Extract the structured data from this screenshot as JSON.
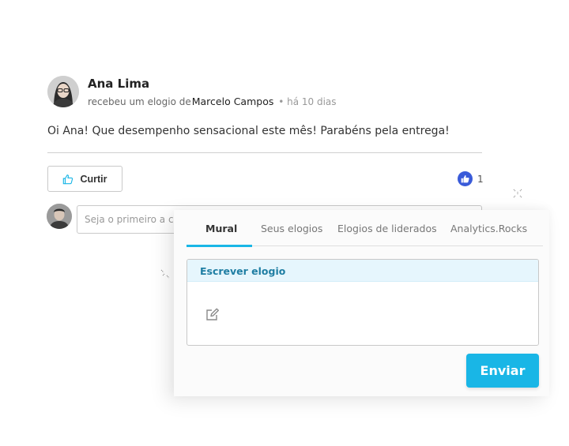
{
  "post": {
    "author": "Ana Lima",
    "received_text": "recebeu um elogio de",
    "giver": "Marcelo Campos",
    "time": "• há 10 dias",
    "message": "Oi Ana! Que desempenho sensacional este mês! Parabéns pela entrega!",
    "like_label": "Curtir",
    "like_count": "1",
    "comment_placeholder": "Seja o primeiro a comentar..."
  },
  "panel": {
    "tabs": [
      "Mural",
      "Seus elogios",
      "Elogios de liderados",
      "Analytics.Rocks"
    ],
    "active_tab": "Mural",
    "compose_header": "Escrever elogio",
    "send_label": "Enviar"
  },
  "colors": {
    "accent": "#19b6e6",
    "like_blue": "#3a5bd9",
    "header_tint": "#e6f6fd",
    "header_text": "#1f7ea3"
  },
  "icons": {
    "like_button": "thumbs-up-icon",
    "like_badge": "thumbs-up-icon",
    "compose": "edit-pencil-icon"
  }
}
